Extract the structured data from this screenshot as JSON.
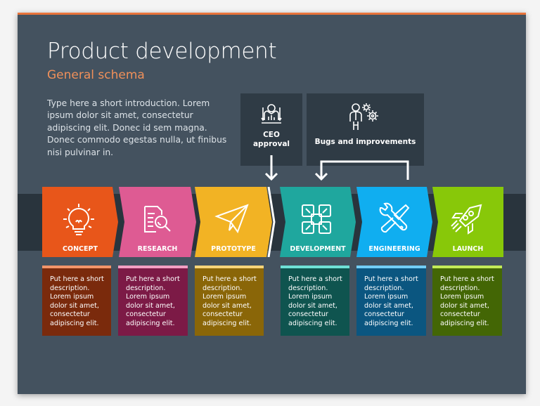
{
  "title": "Product development",
  "subtitle": "General schema",
  "intro": "Type here a short introduction. Lorem ipsum dolor sit amet, consectetur adipiscing elit. Donec id sem magna. Donec commodo egestas nulla, ut finibus nisi pulvinar in.",
  "feedback_boxes": [
    {
      "label_line1": "CEO",
      "label_line2": "approval",
      "icon": "ceo-approval-icon"
    },
    {
      "label": "Bugs and improvements",
      "icon": "person-gears-icon"
    }
  ],
  "stages": [
    {
      "label": "CONCEPT",
      "icon": "lightbulb-icon",
      "color": "#e8561a",
      "desc_bg": "#7a2a0c",
      "desc_bar": "#f2956a",
      "desc": "Put here a short description. Lorem ipsum dolor sit amet, consectetur adipiscing elit."
    },
    {
      "label": "RESEARCH",
      "icon": "document-search-icon",
      "color": "#de5b93",
      "desc_bg": "#7c1a46",
      "desc_bar": "#f29ec2",
      "desc": "Put here a short description. Lorem ipsum dolor sit amet, consectetur adipiscing elit."
    },
    {
      "label": "PROTOTYPE",
      "icon": "paper-plane-icon",
      "color": "#f2b324",
      "desc_bg": "#8a6608",
      "desc_bar": "#f6d47a",
      "desc": "Put here a short description. Lorem ipsum dolor sit amet, consectetur adipiscing elit."
    },
    {
      "label": "DEVELOPMENT",
      "icon": "expand-squares-icon",
      "color": "#1fa79e",
      "desc_bg": "#0f544f",
      "desc_bar": "#6fe0d6",
      "desc": "Put here a short description. Lorem ipsum dolor sit amet, consectetur adipiscing elit."
    },
    {
      "label": "ENGINEERING",
      "icon": "wrench-screwdriver-icon",
      "color": "#10aef0",
      "desc_bg": "#0b5680",
      "desc_bar": "#72cdf5",
      "desc": "Put here a short description. Lorem ipsum dolor sit amet, consectetur adipiscing elit."
    },
    {
      "label": "LAUNCH",
      "icon": "rocket-icon",
      "color": "#88c809",
      "desc_bg": "#436605",
      "desc_bar": "#c2ea58",
      "desc": "Put here a short description. Lorem ipsum dolor sit amet, consectetur adipiscing elit."
    }
  ],
  "colors": {
    "background": "#44525f",
    "accent": "#e8733a",
    "band": "#29343d",
    "box": "#2f3b45"
  }
}
